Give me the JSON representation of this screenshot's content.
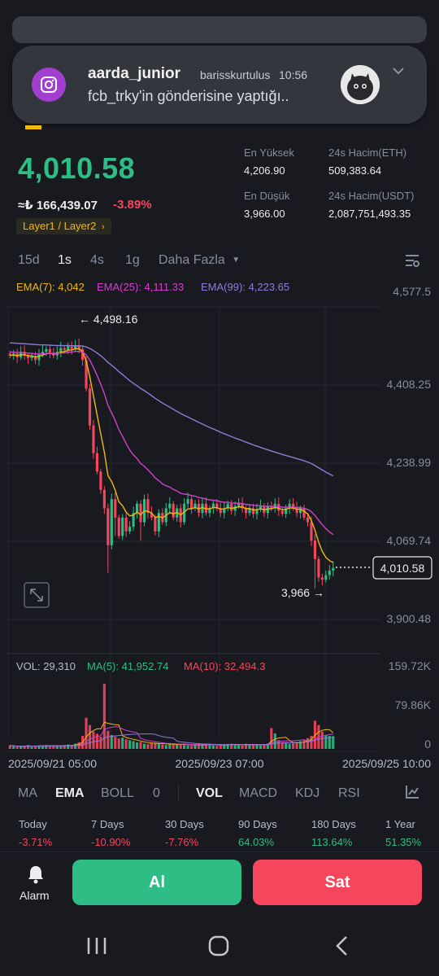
{
  "notification": {
    "title": "aarda_junior",
    "user": "barisskurtulus",
    "time": "10:56",
    "text": "fcb_trky'in gönderisine yaptığı..",
    "app_icon": "instagram-icon",
    "expand_icon": "chevron-down-icon"
  },
  "price": {
    "last": "4,010.58",
    "fiat": "≈₺ 166,439.07",
    "change": "-3.89%",
    "tag": "Layer1 / Layer2",
    "high_label": "En Yüksek",
    "high_value": "4,206.90",
    "low_label": "En Düşük",
    "low_value": "3,966.00",
    "vol_base_label": "24s Hacim(ETH)",
    "vol_base_value": "509,383.64",
    "vol_quote_label": "24s Hacim(USDT)",
    "vol_quote_value": "2,087,751,493.35"
  },
  "timeframes": {
    "tf1": "15d",
    "tf2": "1s",
    "tf3": "4s",
    "tf4": "1g",
    "more": "Daha Fazla"
  },
  "colors": {
    "up": "#2ebd85",
    "down": "#f6465d",
    "ema7": "#f0b90b",
    "ema25": "#d042c9",
    "ema99": "#8f7bd6",
    "accent": "#f0b90b"
  },
  "chart_data": {
    "type": "candlestick",
    "ema_legend": {
      "ema7": "EMA(7): 4,042",
      "ema25": "EMA(25): 4,111.33",
      "ema99": "EMA(99): 4,223.65"
    },
    "y_ticks": [
      "4,577.5",
      "4,408.25",
      "4,238.99",
      "4,069.74",
      "3,900.48"
    ],
    "ylim": [
      3900.48,
      4577.5
    ],
    "current_price_label": "4,010.58",
    "high_annotation": "4,498.16",
    "low_annotation": "3,966",
    "x_labels": [
      "2025/09/21 05:00",
      "2025/09/23 07:00",
      "2025/09/25 10:00"
    ],
    "vol_legend": {
      "vol": "VOL: 29,310",
      "ma5": "MA(5): 41,952.74",
      "ma10": "MA(10): 32,494.3"
    },
    "vol_ticks": [
      "159.72K",
      "79.86K",
      "0"
    ],
    "vol_ylim": [
      0,
      159720
    ],
    "closes": [
      4472,
      4476,
      4468,
      4480,
      4472,
      4466,
      4470,
      4462,
      4474,
      4480,
      4486,
      4478,
      4472,
      4480,
      4488,
      4484,
      4492,
      4486,
      4494,
      4486,
      4462,
      4400,
      4320,
      4260,
      4220,
      4180,
      4140,
      4060,
      4160,
      4120,
      4080,
      4120,
      4090,
      4100,
      4130,
      4150,
      4110,
      4160,
      4130,
      4120,
      4090,
      4130,
      4110,
      4140,
      4150,
      4120,
      4140,
      4110,
      4150,
      4160,
      4140,
      4150,
      4130,
      4150,
      4130,
      4140,
      4150,
      4140,
      4130,
      4140,
      4150,
      4135,
      4145,
      4150,
      4140,
      4130,
      4140,
      4128,
      4138,
      4145,
      4130,
      4145,
      4140,
      4150,
      4135,
      4128,
      4140,
      4150,
      4140,
      4130,
      4140,
      4120,
      4110,
      4070,
      4030,
      3990,
      3985,
      3995,
      4005,
      4010.58
    ],
    "volumes": [
      8000,
      6000,
      5000,
      7000,
      6000,
      9000,
      5000,
      6000,
      8000,
      7000,
      9000,
      6000,
      8000,
      7000,
      6000,
      9000,
      10000,
      8000,
      12000,
      15000,
      30000,
      72000,
      55000,
      40000,
      35000,
      28000,
      150000,
      42000,
      32000,
      28000,
      24000,
      26000,
      22000,
      20000,
      18000,
      15000,
      16000,
      12000,
      11000,
      14000,
      13000,
      12000,
      10000,
      9000,
      12000,
      11000,
      10000,
      9000,
      12000,
      8000,
      7000,
      9000,
      11000,
      10000,
      9000,
      12000,
      8000,
      7000,
      9000,
      10000,
      11000,
      12000,
      10000,
      9000,
      8000,
      12000,
      11000,
      10000,
      9000,
      8000,
      10000,
      12000,
      48000,
      36000,
      20000,
      15000,
      14000,
      12000,
      13000,
      16000,
      18000,
      20000,
      25000,
      30000,
      65000,
      55000,
      40000,
      32000,
      30000,
      29310
    ]
  },
  "indicators": {
    "ma": "MA",
    "ema": "EMA",
    "boll": "BOLL",
    "zero": "0",
    "vol": "VOL",
    "macd": "MACD",
    "kdj": "KDJ",
    "rsi": "RSI"
  },
  "performance": [
    {
      "label": "Today",
      "value": "-3.71%"
    },
    {
      "label": "7 Days",
      "value": "-10.90%"
    },
    {
      "label": "30 Days",
      "value": "-7.76%"
    },
    {
      "label": "90 Days",
      "value": "64.03%"
    },
    {
      "label": "180 Days",
      "value": "113.64%"
    },
    {
      "label": "1 Year",
      "value": "51.35%"
    }
  ],
  "actions": {
    "alarm": "Alarm",
    "buy": "Al",
    "sell": "Sat"
  }
}
